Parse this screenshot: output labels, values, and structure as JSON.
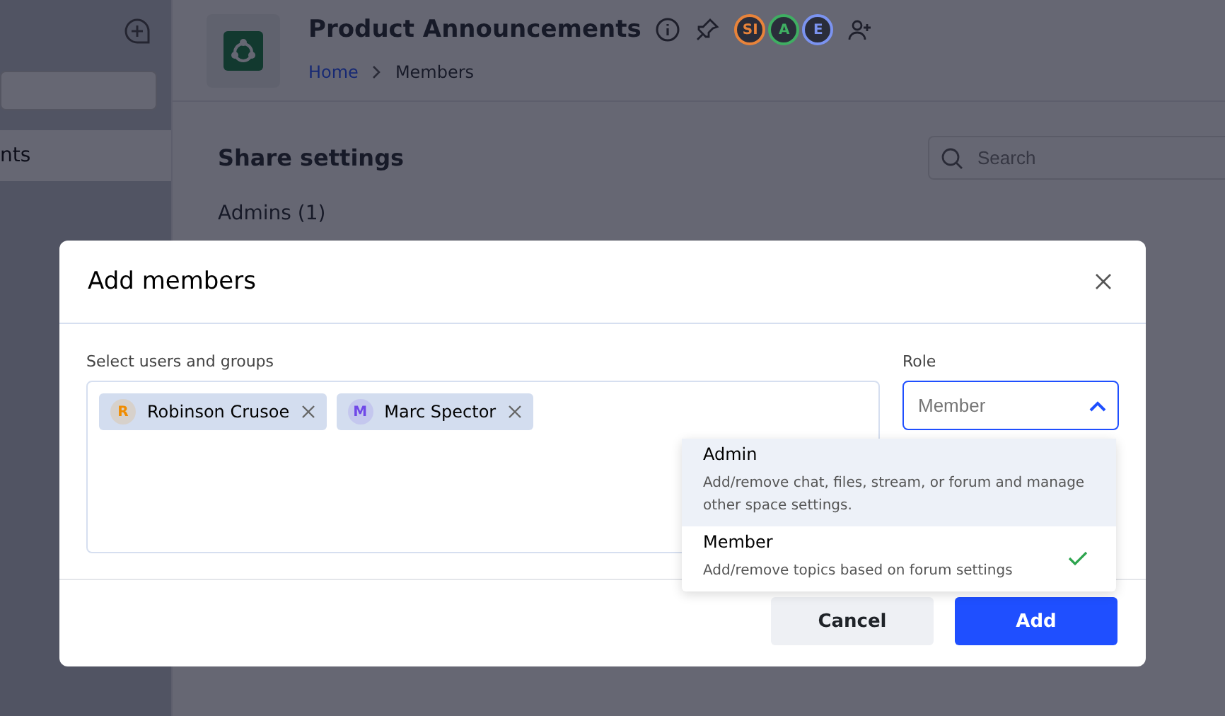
{
  "sidebar": {
    "items": [
      {
        "label": "nts",
        "selected": true
      }
    ]
  },
  "header": {
    "title": "Product Announcements",
    "avatars": [
      {
        "initials": "SI",
        "color": "#e8833a"
      },
      {
        "initials": "A",
        "color": "#3fae62"
      },
      {
        "initials": "E",
        "color": "#7b93f0"
      }
    ],
    "breadcrumb": [
      "Home",
      "Members"
    ]
  },
  "content": {
    "heading": "Share settings",
    "search": {
      "placeholder": "Search"
    },
    "section": "Admins (1)"
  },
  "dialog": {
    "title": "Add members",
    "users_label": "Select users and groups",
    "chips": [
      {
        "initial": "R",
        "name": "Robinson Crusoe",
        "color": "#f08c00"
      },
      {
        "initial": "M",
        "name": "Marc Spector",
        "color": "#7048e8"
      }
    ],
    "role_label": "Role",
    "role": {
      "placeholder": "Member",
      "expanded": true
    },
    "options": [
      {
        "title": "Admin",
        "description": "Add/remove chat, files, stream, or forum and manage other space settings.",
        "hovered": true,
        "selected": false
      },
      {
        "title": "Member",
        "description": "Add/remove topics based on forum settings",
        "hovered": false,
        "selected": true
      }
    ],
    "buttons": [
      {
        "label": "Cancel",
        "kind": "secondary"
      },
      {
        "label": "Add",
        "kind": "primary"
      }
    ]
  }
}
